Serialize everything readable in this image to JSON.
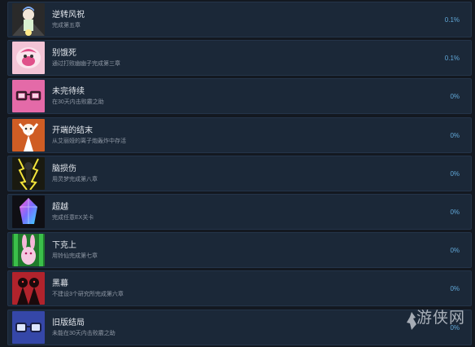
{
  "achievements": [
    {
      "title": "逆转风祝",
      "desc": "完成第五章",
      "pct": "0.1%",
      "icon": "shrine-girl-icon",
      "bg": "#2a2a2a"
    },
    {
      "title": "别饿死",
      "desc": "通过打败幽幽子完成第三章",
      "pct": "0.1%",
      "icon": "pink-ghost-icon",
      "bg": "#f3c4d6"
    },
    {
      "title": "未完待续",
      "desc": "在30天内击败霰之助",
      "pct": "0%",
      "icon": "pink-glasses-icon",
      "bg": "#e46aa8"
    },
    {
      "title": "开端的结末",
      "desc": "从艾丽娅的离子炮轰炸中存活",
      "pct": "0%",
      "icon": "raised-arms-icon",
      "bg": "#cf5d24"
    },
    {
      "title": "脑损伤",
      "desc": "用灵梦完成第八章",
      "pct": "0%",
      "icon": "lightning-figure-icon",
      "bg": "#1a1a10"
    },
    {
      "title": "超越",
      "desc": "完成任意EX关卡",
      "pct": "0%",
      "icon": "crystal-icon",
      "bg": "#0f0f14"
    },
    {
      "title": "下克上",
      "desc": "用铃仙完成第七章",
      "pct": "0%",
      "icon": "rabbit-icon",
      "bg": "#1f7a2b"
    },
    {
      "title": "黑幕",
      "desc": "不建设3个研究所完成第六章",
      "pct": "0%",
      "icon": "dark-figures-icon",
      "bg": "#b1232c"
    },
    {
      "title": "旧版结局",
      "desc": "未能在30天内击败霰之助",
      "pct": "0%",
      "icon": "glasses-icon",
      "bg": "#3547a8"
    }
  ],
  "watermark": "游侠网"
}
